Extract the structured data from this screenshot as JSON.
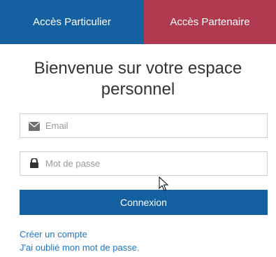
{
  "tabs": [
    {
      "label": "Accès Particulier",
      "color": "#15609f",
      "active": true
    },
    {
      "label": "Accès Partenaire",
      "color": "#b03a50",
      "active": false
    }
  ],
  "title": "Bienvenue sur votre espace personnel",
  "email": {
    "placeholder": "Email",
    "value": "",
    "icon": "envelope-icon"
  },
  "password": {
    "placeholder": "Mot de passe",
    "value": "",
    "icon": "lock-icon"
  },
  "login_button": {
    "label": "Connexion"
  },
  "links": {
    "create_account": "Créer un compte",
    "forgot_password": "J'ai oublié mon mot de passe."
  },
  "colors": {
    "primary": "#15609f",
    "secondary": "#b03a50",
    "link": "#1f76c4"
  }
}
